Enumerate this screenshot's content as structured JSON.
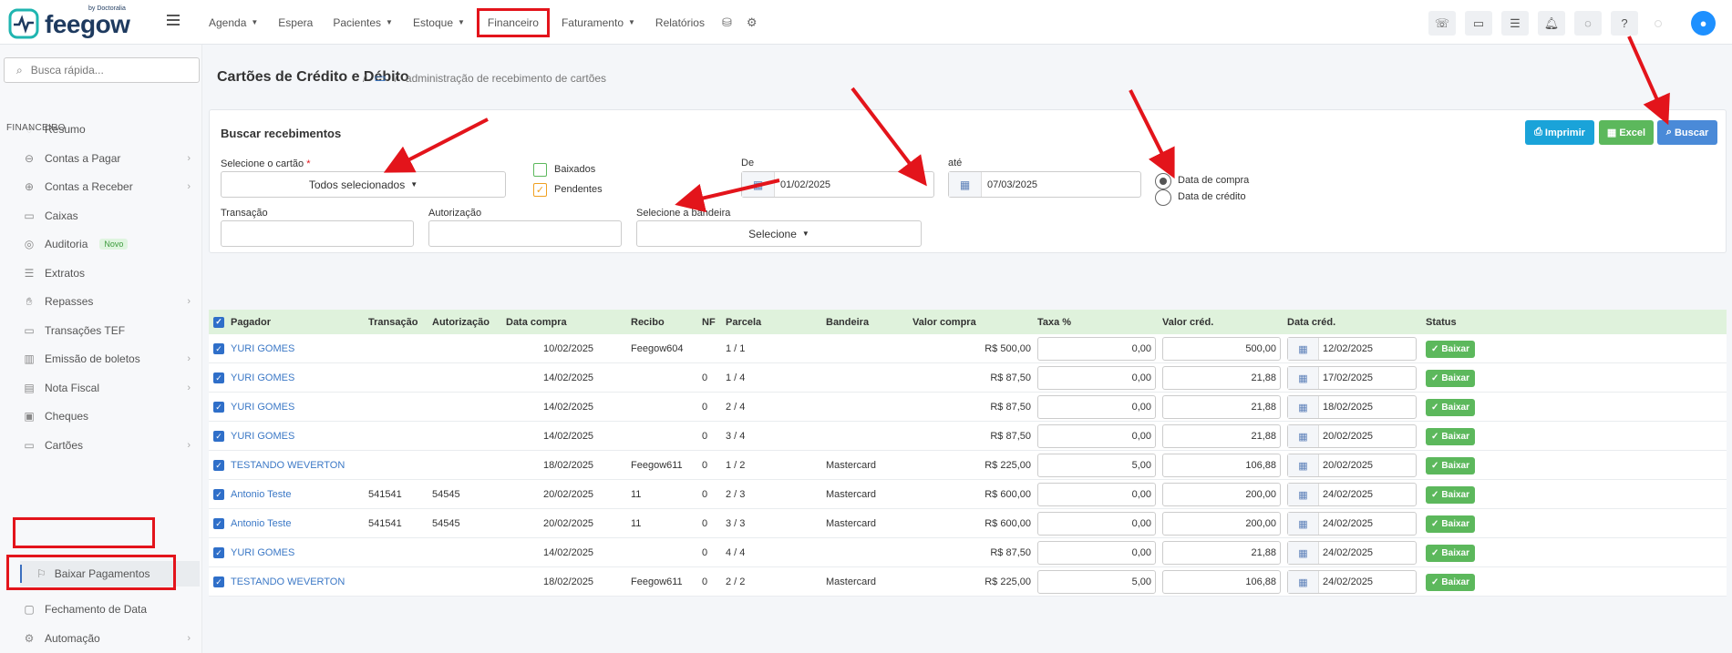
{
  "brand": {
    "logo_text": "feegow",
    "logo_by": "by Doctoralia"
  },
  "nav": {
    "items": [
      {
        "label": "Agenda",
        "dropdown": true
      },
      {
        "label": "Espera",
        "dropdown": false
      },
      {
        "label": "Pacientes",
        "dropdown": true
      },
      {
        "label": "Estoque",
        "dropdown": true
      },
      {
        "label": "Financeiro",
        "dropdown": false,
        "highlighted": true
      },
      {
        "label": "Faturamento",
        "dropdown": true
      },
      {
        "label": "Relatórios",
        "dropdown": false
      }
    ],
    "extra_icons": [
      "database-icon",
      "settings-icon"
    ],
    "right_icons": [
      "phone-icon",
      "inbox-icon",
      "list-icon",
      "bell-icon",
      "chat-icon",
      "help-icon"
    ]
  },
  "sidebar": {
    "search_placeholder": "Busca rápida...",
    "section_title": "FINANCEIRO",
    "items": [
      {
        "label": "Resumo",
        "icon": "chart-icon",
        "chevron": false
      },
      {
        "label": "Contas a Pagar",
        "icon": "minus-circle-icon",
        "chevron": true
      },
      {
        "label": "Contas a Receber",
        "icon": "plus-circle-icon",
        "chevron": true
      },
      {
        "label": "Caixas",
        "icon": "inbox-icon",
        "chevron": false
      },
      {
        "label": "Auditoria",
        "icon": "audit-icon",
        "chevron": false,
        "badge": "Novo"
      },
      {
        "label": "Extratos",
        "icon": "list-icon",
        "chevron": false
      },
      {
        "label": "Repasses",
        "icon": "hand-icon",
        "chevron": true
      },
      {
        "label": "Transações TEF",
        "icon": "card-icon",
        "chevron": false
      },
      {
        "label": "Emissão de boletos",
        "icon": "barcode-icon",
        "chevron": true
      },
      {
        "label": "Nota Fiscal",
        "icon": "document-icon",
        "chevron": true
      },
      {
        "label": "Cheques",
        "icon": "check-doc-icon",
        "chevron": false
      },
      {
        "label": "Cartões",
        "icon": "card-icon",
        "chevron": true,
        "highlighted": true
      }
    ],
    "sub_item": {
      "label": "Baixar Pagamentos",
      "icon": "user-down-icon"
    },
    "after_items": [
      {
        "label": "Fechamento de Data",
        "icon": "lock-icon",
        "chevron": false
      },
      {
        "label": "Automação",
        "icon": "gears-icon",
        "chevron": true
      }
    ]
  },
  "page": {
    "title": "Cartões de Crédito e Débito",
    "breadcrumb_sep": "/",
    "breadcrumb_text": "administração de recebimento de cartões"
  },
  "filters": {
    "card_title": "Buscar recebimentos",
    "buttons": {
      "print": "Imprimir",
      "excel": "Excel",
      "search": "Buscar"
    },
    "card_select_label": "Selecione o cartão",
    "card_select_value": "Todos selecionados",
    "baixados_label": "Baixados",
    "pendentes_label": "Pendentes",
    "de_label": "De",
    "de_value": "01/02/2025",
    "ate_label": "até",
    "ate_value": "07/03/2025",
    "radio_compra": "Data de compra",
    "radio_credito": "Data de crédito",
    "transacao_label": "Transação",
    "autorizacao_label": "Autorização",
    "bandeira_label": "Selecione a bandeira",
    "bandeira_value": "Selecione"
  },
  "table": {
    "headers": [
      "Pagador",
      "Transação",
      "Autorização",
      "Data compra",
      "Recibo",
      "NF",
      "Parcela",
      "Bandeira",
      "Valor compra",
      "Taxa %",
      "Valor créd.",
      "Data créd.",
      "Status"
    ],
    "action_label": "Baixar",
    "rows": [
      {
        "pagador": "YURI GOMES",
        "transacao": "",
        "autorizacao": "",
        "data_compra": "10/02/2025",
        "recibo": "Feegow604",
        "nf": "",
        "parcela": "1 / 1",
        "bandeira": "",
        "valor_compra": "R$ 500,00",
        "taxa": "0,00",
        "valor_cred": "500,00",
        "data_cred": "12/02/2025"
      },
      {
        "pagador": "YURI GOMES",
        "transacao": "",
        "autorizacao": "",
        "data_compra": "14/02/2025",
        "recibo": "",
        "nf": "0",
        "parcela": "1 / 4",
        "bandeira": "",
        "valor_compra": "R$ 87,50",
        "taxa": "0,00",
        "valor_cred": "21,88",
        "data_cred": "17/02/2025"
      },
      {
        "pagador": "YURI GOMES",
        "transacao": "",
        "autorizacao": "",
        "data_compra": "14/02/2025",
        "recibo": "",
        "nf": "0",
        "parcela": "2 / 4",
        "bandeira": "",
        "valor_compra": "R$ 87,50",
        "taxa": "0,00",
        "valor_cred": "21,88",
        "data_cred": "18/02/2025"
      },
      {
        "pagador": "YURI GOMES",
        "transacao": "",
        "autorizacao": "",
        "data_compra": "14/02/2025",
        "recibo": "",
        "nf": "0",
        "parcela": "3 / 4",
        "bandeira": "",
        "valor_compra": "R$ 87,50",
        "taxa": "0,00",
        "valor_cred": "21,88",
        "data_cred": "20/02/2025"
      },
      {
        "pagador": "TESTANDO WEVERTON",
        "transacao": "",
        "autorizacao": "",
        "data_compra": "18/02/2025",
        "recibo": "Feegow611",
        "nf": "0",
        "parcela": "1 / 2",
        "bandeira": "Mastercard",
        "valor_compra": "R$ 225,00",
        "taxa": "5,00",
        "valor_cred": "106,88",
        "data_cred": "20/02/2025"
      },
      {
        "pagador": "Antonio Teste",
        "transacao": "541541",
        "autorizacao": "54545",
        "data_compra": "20/02/2025",
        "recibo": "11",
        "nf": "0",
        "parcela": "2 / 3",
        "bandeira": "Mastercard",
        "valor_compra": "R$ 600,00",
        "taxa": "0,00",
        "valor_cred": "200,00",
        "data_cred": "24/02/2025"
      },
      {
        "pagador": "Antonio Teste",
        "transacao": "541541",
        "autorizacao": "54545",
        "data_compra": "20/02/2025",
        "recibo": "11",
        "nf": "0",
        "parcela": "3 / 3",
        "bandeira": "Mastercard",
        "valor_compra": "R$ 600,00",
        "taxa": "0,00",
        "valor_cred": "200,00",
        "data_cred": "24/02/2025"
      },
      {
        "pagador": "YURI GOMES",
        "transacao": "",
        "autorizacao": "",
        "data_compra": "14/02/2025",
        "recibo": "",
        "nf": "0",
        "parcela": "4 / 4",
        "bandeira": "",
        "valor_compra": "R$ 87,50",
        "taxa": "0,00",
        "valor_cred": "21,88",
        "data_cred": "24/02/2025"
      },
      {
        "pagador": "TESTANDO WEVERTON",
        "transacao": "",
        "autorizacao": "",
        "data_compra": "18/02/2025",
        "recibo": "Feegow611",
        "nf": "0",
        "parcela": "2 / 2",
        "bandeira": "Mastercard",
        "valor_compra": "R$ 225,00",
        "taxa": "5,00",
        "valor_cred": "106,88",
        "data_cred": "24/02/2025"
      }
    ]
  },
  "colors": {
    "accent": "#3b78c6",
    "highlight": "#e3141b",
    "success": "#5cb85c",
    "print": "#1aa3d9",
    "excel": "#5cb85c",
    "search": "#4a8ad8"
  }
}
